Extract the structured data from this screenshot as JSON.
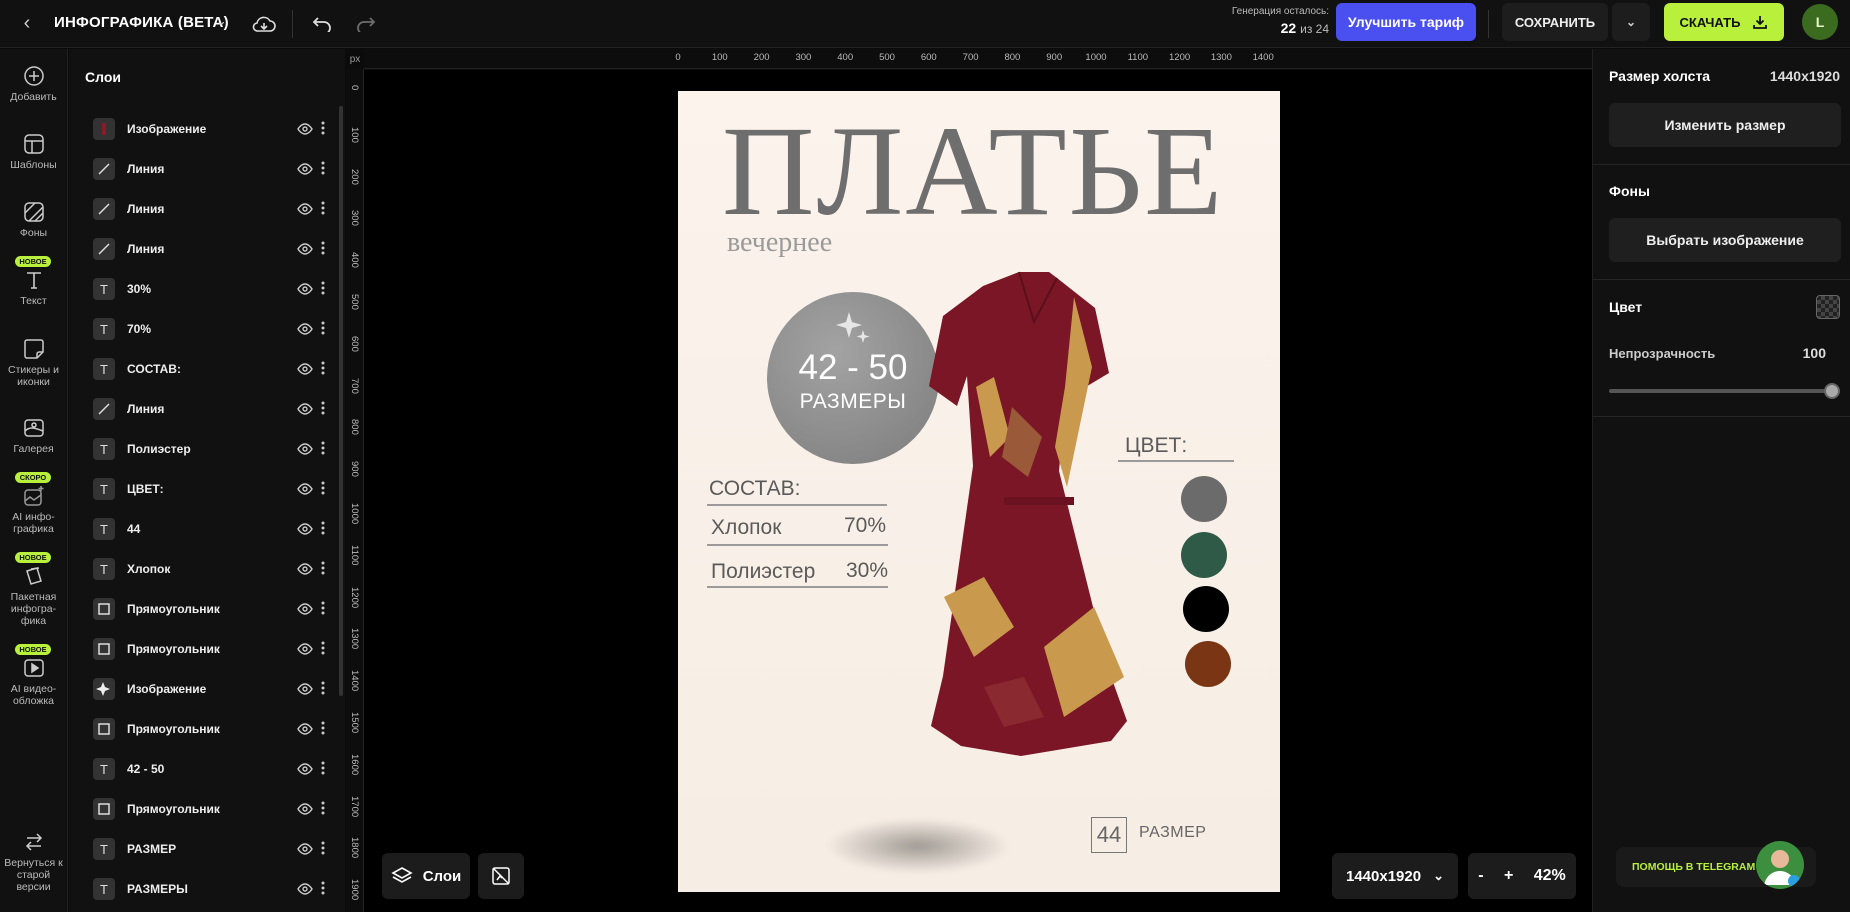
{
  "header": {
    "title": "ИНФОГРАФИКА (BETA)",
    "gen_label": "Генерация осталось:",
    "gen_used": "22",
    "gen_total": "из 24",
    "upgrade": "Улучшить тариф",
    "save": "СОХРАНИТЬ",
    "download": "СКАЧАТЬ",
    "avatar": "L"
  },
  "rail": [
    {
      "label": "Добавить",
      "icon": "plus-circle-icon",
      "badge": ""
    },
    {
      "label": "Шаблоны",
      "icon": "template-icon",
      "badge": ""
    },
    {
      "label": "Фоны",
      "icon": "background-icon",
      "badge": ""
    },
    {
      "label": "Текст",
      "icon": "text-icon",
      "badge": "НОВОЕ"
    },
    {
      "label": "Стикеры и иконки",
      "icon": "sticker-icon",
      "badge": ""
    },
    {
      "label": "Галерея",
      "icon": "gallery-icon",
      "badge": ""
    },
    {
      "label": "AI инфо-графика",
      "icon": "ai-image-icon",
      "badge": "СКОРО"
    },
    {
      "label": "Пакетная инфогра-фика",
      "icon": "batch-icon",
      "badge": "НОВОЕ"
    },
    {
      "label": "AI видео-обложка",
      "icon": "video-icon",
      "badge": "НОВОЕ"
    },
    {
      "label": "Вернуться к старой версии",
      "icon": "switch-icon",
      "badge": ""
    }
  ],
  "layers": {
    "title": "Слои",
    "items": [
      {
        "name": "Изображение",
        "type": "image"
      },
      {
        "name": "Линия",
        "type": "line"
      },
      {
        "name": "Линия",
        "type": "line"
      },
      {
        "name": "Линия",
        "type": "line"
      },
      {
        "name": "30%",
        "type": "text"
      },
      {
        "name": "70%",
        "type": "text"
      },
      {
        "name": "СОСТАВ:",
        "type": "text"
      },
      {
        "name": "Линия",
        "type": "line"
      },
      {
        "name": "Полиэстер",
        "type": "text"
      },
      {
        "name": "ЦВЕТ:",
        "type": "text"
      },
      {
        "name": "44",
        "type": "text"
      },
      {
        "name": "Хлопок",
        "type": "text"
      },
      {
        "name": "Прямоугольник",
        "type": "rect"
      },
      {
        "name": "Прямоугольник",
        "type": "rect"
      },
      {
        "name": "Изображение",
        "type": "sparkle"
      },
      {
        "name": "Прямоугольник",
        "type": "rect"
      },
      {
        "name": "42 - 50",
        "type": "text"
      },
      {
        "name": "Прямоугольник",
        "type": "rect"
      },
      {
        "name": "РАЗМЕР",
        "type": "text"
      },
      {
        "name": "РАЗМЕРЫ",
        "type": "text"
      }
    ]
  },
  "ruler": {
    "unit": "px",
    "h": [
      "0",
      "100",
      "200",
      "300",
      "400",
      "500",
      "600",
      "700",
      "800",
      "900",
      "1000",
      "1100",
      "1200",
      "1300",
      "1400"
    ],
    "v": [
      "0",
      "100",
      "200",
      "300",
      "400",
      "500",
      "600",
      "700",
      "800",
      "900",
      "1000",
      "1100",
      "1200",
      "1300",
      "1400",
      "1500",
      "1600",
      "1700",
      "1800",
      "1900"
    ]
  },
  "artboard": {
    "title": "ПЛАТЬЕ",
    "subtitle": "вечернее",
    "sizes_range": "42 - 50",
    "sizes_label": "РАЗМЕРЫ",
    "composition_label": "СОСТАВ:",
    "material1": "Хлопок",
    "pct1": "70%",
    "material2": "Полиэстер",
    "pct2": "30%",
    "color_label": "ЦВЕТ:",
    "swatches": [
      "#6b6b6b",
      "#2f5a48",
      "#000000",
      "#7a3514"
    ],
    "size_value": "44",
    "size_label": "РАЗМЕР"
  },
  "bottom": {
    "layers_btn": "Слои",
    "canvas_size": "1440x1920",
    "zoom": "42%",
    "minus": "-",
    "plus": "+"
  },
  "right": {
    "canvas_label": "Размер холста",
    "canvas_value": "1440x1920",
    "resize": "Изменить размер",
    "bg_label": "Фоны",
    "choose_image": "Выбрать изображение",
    "color_label": "Цвет",
    "opacity_label": "Непрозрачность",
    "opacity_value": "100",
    "help": "ПОМОЩЬ В TELEGRAM"
  }
}
